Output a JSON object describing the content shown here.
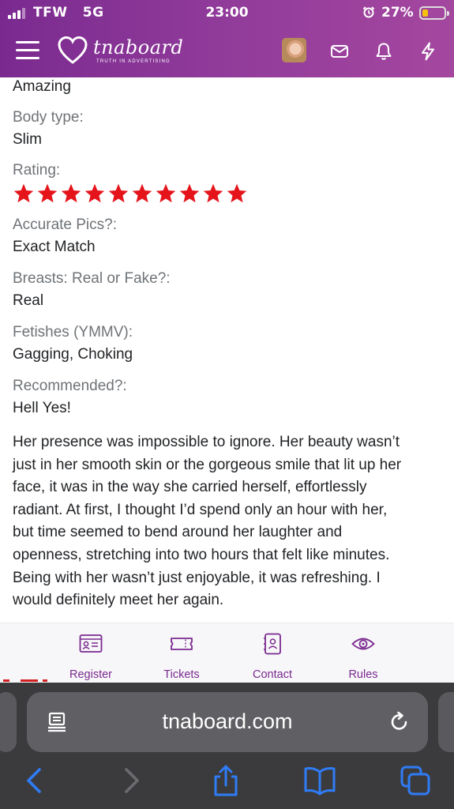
{
  "status_bar": {
    "carrier": "TFW",
    "network": "5G",
    "time": "23:00",
    "battery_percent": "27%",
    "battery_level": 0.27,
    "battery_color": "#f4c20d"
  },
  "header": {
    "brand": "tnaboard",
    "tagline": "TRUTH IN ADVERTISING",
    "icons": [
      "menu-icon",
      "profile-avatar",
      "mail-icon",
      "bell-icon",
      "lightning-icon"
    ]
  },
  "review": {
    "partial_value": "Amazing",
    "fields": [
      {
        "label": "Body type:",
        "value": "Slim"
      },
      {
        "label": "Rating:",
        "stars": 10
      },
      {
        "label": "Accurate Pics?:",
        "value": "Exact Match"
      },
      {
        "label": "Breasts: Real or Fake?:",
        "value": "Real"
      },
      {
        "label": "Fetishes (YMMV):",
        "value": "Gagging, Choking"
      },
      {
        "label": "Recommended?:",
        "value": "Hell Yes!"
      }
    ],
    "text_lines": [
      "Her presence was impossible to ignore. Her beauty wasn’t",
      "just in her smooth skin or the gorgeous smile that lit up her",
      "face, it was in the way she carried herself, effortlessly",
      "radiant. At first, I thought I’d spend only an hour with her,",
      "but time seemed to bend around her laughter and",
      "openness, stretching into two hours that felt like minutes.",
      "Being with her wasn’t just enjoyable, it was refreshing. I",
      "would definitely meet her again."
    ]
  },
  "bottom_nav": {
    "items": [
      {
        "label": "Register",
        "icon": "id-card-icon"
      },
      {
        "label": "Tickets",
        "icon": "ticket-icon"
      },
      {
        "label": "Contact",
        "icon": "contact-icon"
      },
      {
        "label": "Rules",
        "icon": "eye-icon"
      }
    ]
  },
  "browser": {
    "url": "tnaboard.com",
    "toolbar": [
      "back-icon",
      "forward-icon",
      "share-icon",
      "bookmarks-icon",
      "tabs-icon"
    ]
  },
  "colors": {
    "brand_purple": "#7a2a8f",
    "star_red": "#e5141b",
    "ios_blue": "#2f7cf6"
  }
}
